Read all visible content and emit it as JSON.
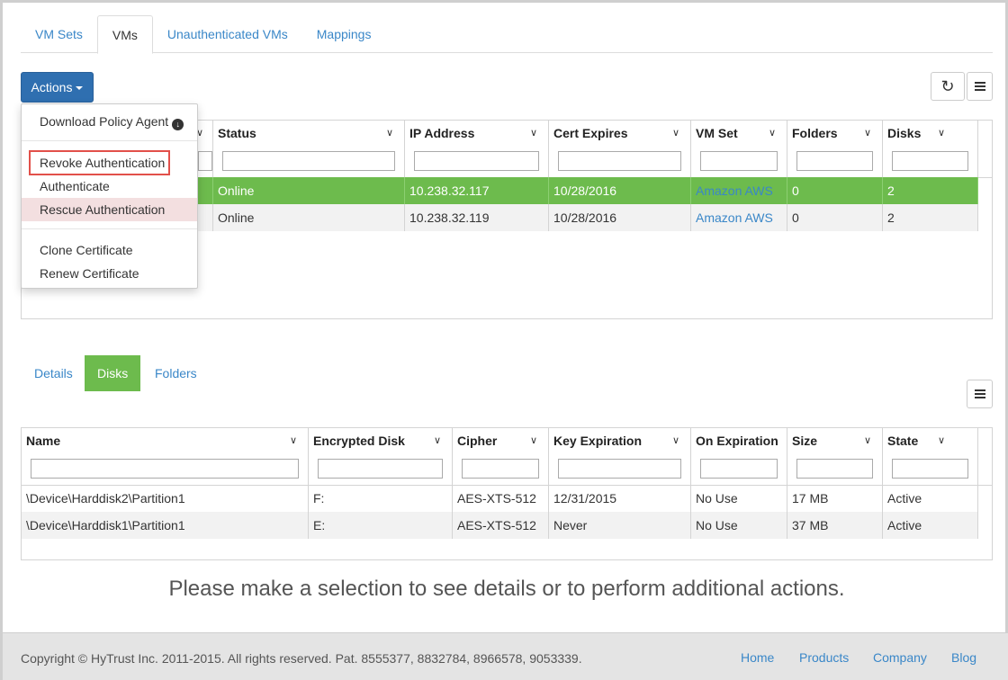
{
  "tabs": [
    "VM Sets",
    "VMs",
    "Unauthenticated VMs",
    "Mappings"
  ],
  "actions": {
    "label": "Actions"
  },
  "toolbar": {
    "refresh_icon": "refresh-icon",
    "columns_icon": "list-icon"
  },
  "dropdown": {
    "items": [
      {
        "label": "Download Policy Agent",
        "icon": "download-icon"
      },
      {
        "label": "Revoke Authentication"
      },
      {
        "label": "Authenticate"
      },
      {
        "label": "Rescue Authentication"
      },
      {
        "label": "Clone Certificate"
      },
      {
        "label": "Renew Certificate"
      }
    ]
  },
  "vm_grid": {
    "columns": [
      "Status",
      "IP Address",
      "Cert Expires",
      "VM Set",
      "Folders",
      "Disks"
    ],
    "rows": [
      {
        "status": "Online",
        "ip": "10.238.32.117",
        "cert": "10/28/2016",
        "vmset": "Amazon AWS",
        "folders": "0",
        "disks": "2",
        "selected": true
      },
      {
        "status": "Online",
        "ip": "10.238.32.119",
        "cert": "10/28/2016",
        "vmset": "Amazon AWS",
        "folders": "0",
        "disks": "2",
        "selected": false
      }
    ]
  },
  "subtabs": [
    "Details",
    "Disks",
    "Folders"
  ],
  "disk_grid": {
    "columns": [
      "Name",
      "Encrypted Disk",
      "Cipher",
      "Key Expiration",
      "On Expiration",
      "Size",
      "State"
    ],
    "rows": [
      {
        "name": "\\Device\\Harddisk2\\Partition1",
        "enc": "F:",
        "cipher": "AES-XTS-512",
        "keyexp": "12/31/2015",
        "onexp": "No Use",
        "size": "17 MB",
        "state": "Active"
      },
      {
        "name": "\\Device\\Harddisk1\\Partition1",
        "enc": "E:",
        "cipher": "AES-XTS-512",
        "keyexp": "Never",
        "onexp": "No Use",
        "size": "37 MB",
        "state": "Active"
      }
    ]
  },
  "message": "Please make a selection to see details or to perform additional actions.",
  "footer": {
    "copyright": "Copyright © HyTrust Inc. 2011-2015. All rights reserved. Pat. 8555377, 8832784, 8966578, 9053339.",
    "links": [
      "Home",
      "Products",
      "Company",
      "Blog"
    ]
  },
  "colors": {
    "accent": "#2f6fb0",
    "selected_row": "#6dbb4d",
    "link": "#3a87c8"
  }
}
